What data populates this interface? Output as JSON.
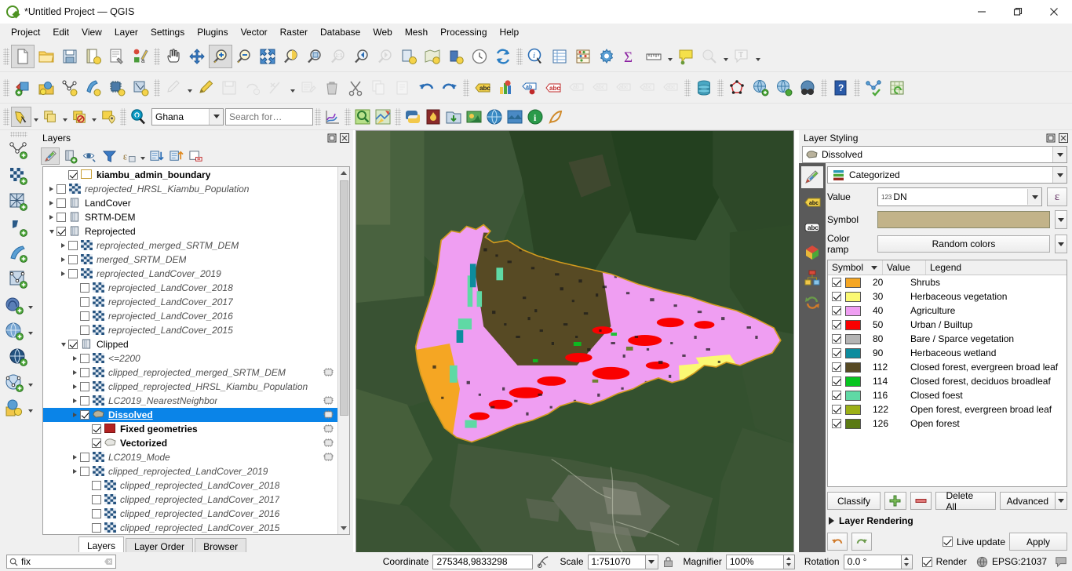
{
  "window": {
    "title": "*Untitled Project — QGIS",
    "logo_icon": "qgis-logo-icon",
    "minimize_label": "—",
    "maximize_label": "❐",
    "close_label": "✕"
  },
  "menubar": {
    "items": [
      {
        "label": "Project",
        "name": "menu-project"
      },
      {
        "label": "Edit",
        "name": "menu-edit"
      },
      {
        "label": "View",
        "name": "menu-view"
      },
      {
        "label": "Layer",
        "name": "menu-layer"
      },
      {
        "label": "Settings",
        "name": "menu-settings"
      },
      {
        "label": "Plugins",
        "name": "menu-plugins"
      },
      {
        "label": "Vector",
        "name": "menu-vector"
      },
      {
        "label": "Raster",
        "name": "menu-raster"
      },
      {
        "label": "Database",
        "name": "menu-database"
      },
      {
        "label": "Web",
        "name": "menu-web"
      },
      {
        "label": "Mesh",
        "name": "menu-mesh"
      },
      {
        "label": "Processing",
        "name": "menu-processing"
      },
      {
        "label": "Help",
        "name": "menu-help"
      }
    ]
  },
  "toolbar_row1": {
    "icons": [
      "new-project-icon",
      "open-project-icon",
      "save-project-icon",
      "save-project-as-icon",
      "new-print-layout-icon",
      "style-manager-icon",
      "pan-map-icon",
      "pan-to-selection-icon",
      "zoom-in-icon",
      "zoom-out-icon",
      "zoom-full-icon",
      "zoom-to-selection-icon",
      "zoom-to-layer-icon",
      "zoom-native-icon",
      "zoom-last-icon",
      "zoom-next-icon",
      "refresh-layer-icon",
      "new-map-view-icon",
      "new-3d-view-icon",
      "identify-history-icon",
      "refresh-icon",
      "identify-features-icon",
      "open-attribute-table-icon",
      "field-calculator-icon",
      "processing-toolbox-icon",
      "statistical-summary-icon",
      "measure-line-icon",
      "map-tips-icon",
      "show-bookmarks-icon",
      "new-text-annotation-icon"
    ]
  },
  "toolbar_row2": {
    "icons": [
      "add-layer-icon",
      "browser-panel-icon",
      "new-vector-layer-icon",
      "new-geopackage-icon",
      "new-memory-layer-icon",
      "new-shapefile-icon",
      "current-edits-icon",
      "toggle-editing-icon",
      "save-layer-edits-icon",
      "vertex-tool-icon",
      "modify-attributes-icon",
      "multi-edit-icon",
      "delete-selected-icon",
      "cut-features-icon",
      "copy-features-icon",
      "paste-features-icon",
      "undo-icon",
      "redo-icon",
      "label-icon",
      "diagram-icon",
      "pin-labels-icon",
      "show-hidden-labels-icon",
      "highlight-pinned-labels-icon",
      "move-label-icon",
      "rotate-label-icon",
      "change-label-icon",
      "database-manager-icon",
      "topology-checker-icon",
      "add-wms-layer-icon",
      "metasearch-icon",
      "qgis-browser-icon",
      "help-contents-icon",
      "georeferencer-icon",
      "refresh-table-icon"
    ]
  },
  "toolbar_row3": {
    "icons": [
      "select-features-icon",
      "deselect-icon",
      "select-all-icon",
      "select-by-location-icon",
      "quickosm-search-icon"
    ],
    "country_select": "Ghana",
    "search_placeholder": "Search for…",
    "right_icons": [
      "plot-icon",
      "quick-map-services-icon",
      "qgis2web-icon",
      "python-console-icon",
      "fire-plugin-icon",
      "open-data-source-icon",
      "semi-automatic-classification-icon",
      "globe-plugin-icon",
      "inasafe-icon",
      "info-tool-icon",
      "lizmap-icon"
    ]
  },
  "vertical_toolbar": {
    "icons": [
      "add-vector-layer-icon",
      "add-raster-layer-icon",
      "add-mesh-layer-icon",
      "add-delimited-text-layer-icon",
      "add-spatialite-layer-icon",
      "add-vector-tile-layer-icon",
      "add-postgis-layer-icon",
      "add-wms-wmts-layer-icon",
      "add-wcs-layer-icon",
      "add-wfs-layer-icon",
      "add-virtual-layer-icon"
    ]
  },
  "layers_panel": {
    "title": "Layers",
    "float_icon": "undock-panel-icon",
    "close_icon": "close-panel-icon",
    "toolbar_icons": [
      "open-layer-styling-icon",
      "add-group-icon",
      "manage-visibility-icon",
      "filter-legend-icon",
      "filter-legend-expression-icon",
      "expand-all-icon",
      "collapse-all-icon",
      "remove-layer-icon"
    ],
    "tabs": [
      {
        "label": "Layers",
        "name": "tab-layers",
        "active": true
      },
      {
        "label": "Layer Order",
        "name": "tab-layer-order",
        "active": false
      },
      {
        "label": "Browser",
        "name": "tab-browser",
        "active": false
      }
    ],
    "tree": [
      {
        "label": "kiambu_admin_boundary",
        "indent": 1,
        "twist": "none",
        "checked": true,
        "icon": "polygon-outline-icon",
        "style": "bold",
        "edit": false
      },
      {
        "label": "reprojected_HRSL_Kiambu_Population",
        "indent": 0,
        "twist": "closed",
        "checked": false,
        "icon": "raster-icon",
        "style": "italic",
        "edit": false
      },
      {
        "label": "LandCover",
        "indent": 0,
        "twist": "closed",
        "checked": false,
        "icon": "group-icon",
        "style": "normal",
        "edit": false
      },
      {
        "label": "SRTM-DEM",
        "indent": 0,
        "twist": "closed",
        "checked": false,
        "icon": "group-icon",
        "style": "normal",
        "edit": false
      },
      {
        "label": "Reprojected",
        "indent": 0,
        "twist": "open",
        "checked": true,
        "icon": "group-icon",
        "style": "normal",
        "edit": false
      },
      {
        "label": "reprojected_merged_SRTM_DEM",
        "indent": 1,
        "twist": "closed",
        "checked": false,
        "icon": "raster-icon",
        "style": "italic",
        "edit": false
      },
      {
        "label": "merged_SRTM_DEM",
        "indent": 1,
        "twist": "closed",
        "checked": false,
        "icon": "raster-icon",
        "style": "italic",
        "edit": false
      },
      {
        "label": "reprojected_LandCover_2019",
        "indent": 1,
        "twist": "closed",
        "checked": false,
        "icon": "raster-icon",
        "style": "italic",
        "edit": false
      },
      {
        "label": "reprojected_LandCover_2018",
        "indent": 2,
        "twist": "none",
        "checked": false,
        "icon": "raster-icon",
        "style": "italic",
        "edit": false
      },
      {
        "label": "reprojected_LandCover_2017",
        "indent": 2,
        "twist": "none",
        "checked": false,
        "icon": "raster-icon",
        "style": "italic",
        "edit": false
      },
      {
        "label": "reprojected_LandCover_2016",
        "indent": 2,
        "twist": "none",
        "checked": false,
        "icon": "raster-icon",
        "style": "italic",
        "edit": false
      },
      {
        "label": "reprojected_LandCover_2015",
        "indent": 2,
        "twist": "none",
        "checked": false,
        "icon": "raster-icon",
        "style": "italic",
        "edit": false
      },
      {
        "label": "Clipped",
        "indent": 1,
        "twist": "open",
        "checked": true,
        "icon": "group-icon",
        "style": "normal",
        "edit": false
      },
      {
        "label": "<=2200",
        "indent": 2,
        "twist": "closed",
        "checked": false,
        "icon": "raster-icon",
        "style": "italic",
        "edit": false
      },
      {
        "label": "clipped_reprojected_merged_SRTM_DEM",
        "indent": 2,
        "twist": "closed",
        "checked": false,
        "icon": "raster-icon",
        "style": "italic",
        "edit": true
      },
      {
        "label": "clipped_reprojected_HRSL_Kiambu_Population",
        "indent": 2,
        "twist": "closed",
        "checked": false,
        "icon": "raster-icon",
        "style": "italic",
        "edit": false
      },
      {
        "label": "LC2019_NearestNeighbor",
        "indent": 2,
        "twist": "closed",
        "checked": false,
        "icon": "raster-icon",
        "style": "italic",
        "edit": true
      },
      {
        "label": "Dissolved",
        "indent": 2,
        "twist": "closed",
        "checked": true,
        "icon": "polygon-fill-icon",
        "style": "selected",
        "edit": true,
        "selected": true
      },
      {
        "label": "Fixed geometries",
        "indent": 3,
        "twist": "none",
        "checked": true,
        "icon": "red-square-icon",
        "style": "bold",
        "edit": true
      },
      {
        "label": "Vectorized",
        "indent": 3,
        "twist": "none",
        "checked": true,
        "icon": "polygon-grey-icon",
        "style": "bold",
        "edit": true
      },
      {
        "label": "LC2019_Mode",
        "indent": 2,
        "twist": "closed",
        "checked": false,
        "icon": "raster-icon",
        "style": "italic",
        "edit": true
      },
      {
        "label": "clipped_reprojected_LandCover_2019",
        "indent": 2,
        "twist": "closed",
        "checked": false,
        "icon": "raster-icon",
        "style": "italic",
        "edit": false
      },
      {
        "label": "clipped_reprojected_LandCover_2018",
        "indent": 3,
        "twist": "none",
        "checked": false,
        "icon": "raster-icon",
        "style": "italic",
        "edit": false
      },
      {
        "label": "clipped_reprojected_LandCover_2017",
        "indent": 3,
        "twist": "none",
        "checked": false,
        "icon": "raster-icon",
        "style": "italic",
        "edit": false
      },
      {
        "label": "clipped_reprojected_LandCover_2016",
        "indent": 3,
        "twist": "none",
        "checked": false,
        "icon": "raster-icon",
        "style": "italic",
        "edit": false
      },
      {
        "label": "clipped_reprojected_LandCover_2015",
        "indent": 3,
        "twist": "none",
        "checked": false,
        "icon": "raster-icon",
        "style": "italic",
        "edit": false
      }
    ]
  },
  "style_panel": {
    "title": "Layer Styling",
    "float_icon": "undock-panel-icon",
    "close_icon": "close-panel-icon",
    "layer_select": "Dissolved",
    "layer_icon": "polygon-fill-icon",
    "renderer_select": "Categorized",
    "renderer_icon": "categorized-icon",
    "value_label": "Value",
    "value_select": "DN",
    "value_prefix": "123",
    "expression_button": "ε",
    "symbol_label": "Symbol",
    "symbol_color": "#c2b389",
    "colorramp_label": "Color ramp",
    "colorramp_value": "Random colors",
    "tabs": [
      {
        "name": "symbology-tab",
        "icon": "paintbrush-icon",
        "active": true
      },
      {
        "name": "labels-tab",
        "icon": "labels-abc-icon",
        "active": false
      },
      {
        "name": "masks-tab",
        "icon": "masks-abc-icon",
        "active": false
      },
      {
        "name": "3d-view-tab",
        "icon": "cube-3d-icon",
        "active": false
      },
      {
        "name": "diagrams-tab",
        "icon": "diagram-icon",
        "active": false
      },
      {
        "name": "history-tab",
        "icon": "undo-history-icon",
        "active": false
      }
    ],
    "table_headers": [
      "Symbol",
      "Value",
      "Legend"
    ],
    "categories": [
      {
        "checked": true,
        "color": "#f5a623",
        "value": "20",
        "legend": "Shrubs"
      },
      {
        "checked": true,
        "color": "#fbf973",
        "value": "30",
        "legend": "Herbaceous vegetation"
      },
      {
        "checked": true,
        "color": "#ef9ef2",
        "value": "40",
        "legend": "Agriculture"
      },
      {
        "checked": true,
        "color": "#fa0000",
        "value": "50",
        "legend": "Urban / Builtup"
      },
      {
        "checked": true,
        "color": "#b4b4b4",
        "value": "80",
        "legend": "Bare / Sparce vegetation"
      },
      {
        "checked": true,
        "color": "#0d8c9e",
        "value": "90",
        "legend": "Herbaceous wetland"
      },
      {
        "checked": true,
        "color": "#574a24",
        "value": "112",
        "legend": "Closed forest, evergreen broad leaf"
      },
      {
        "checked": true,
        "color": "#07c520",
        "value": "114",
        "legend": "Closed forest, deciduos broadleaf"
      },
      {
        "checked": true,
        "color": "#5fd9a5",
        "value": "116",
        "legend": "Closed foest"
      },
      {
        "checked": true,
        "color": "#9cb016",
        "value": "122",
        "legend": "Open forest, evergreen broad leaf"
      },
      {
        "checked": true,
        "color": "#5b7a12",
        "value": "126",
        "legend": "Open forest"
      }
    ],
    "buttons": {
      "classify": "Classify",
      "add_icon": "add-category-icon",
      "remove_icon": "remove-category-icon",
      "delete_all": "Delete All",
      "advanced": "Advanced"
    },
    "layer_rendering": "Layer Rendering",
    "undo_icon": "undo-icon",
    "redo_icon": "redo-icon",
    "live_update": "Live update",
    "live_update_checked": true,
    "apply": "Apply"
  },
  "statusbar": {
    "search_icon": "search-icon",
    "search_value": "fix",
    "search_clear_icon": "clear-icon",
    "coordinate_label": "Coordinate",
    "coordinate_value": "275348,9833298",
    "toggle_extents_icon": "toggle-extents-icon",
    "scale_label": "Scale",
    "scale_value": "1:751070",
    "lock_icon": "lock-scale-icon",
    "magnifier_label": "Magnifier",
    "magnifier_value": "100%",
    "rotation_label": "Rotation",
    "rotation_value": "0.0 °",
    "render_label": "Render",
    "render_checked": true,
    "crs_icon": "crs-globe-icon",
    "crs_label": "EPSG:21037",
    "messages_icon": "messages-icon"
  }
}
